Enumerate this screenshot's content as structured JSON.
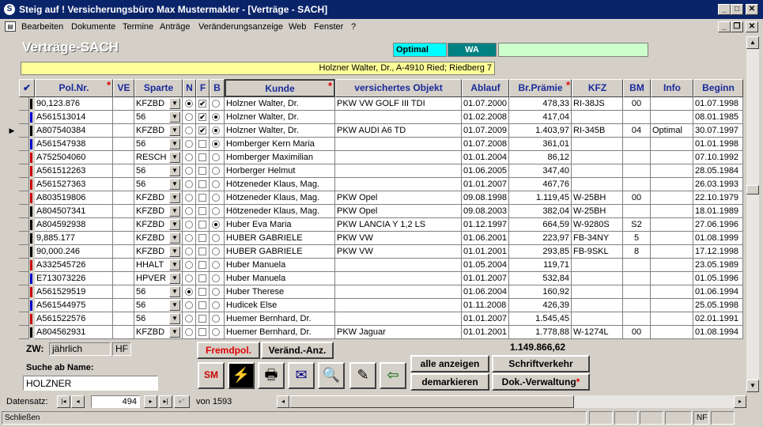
{
  "window": {
    "title": "Steig auf ! Versicherungsbüro Max Mustermakler - [Verträge - SACH]",
    "controls": {
      "minimize": "_",
      "maximize": "□",
      "close": "✕"
    },
    "mdi_controls": {
      "minimize": "_",
      "restore": "❐",
      "close": "✕"
    }
  },
  "menu": [
    "Bearbeiten",
    "Dokumente",
    "Termine",
    "Anträge",
    "Veränderungsanzeige",
    "Web",
    "Fenster",
    "?"
  ],
  "form": {
    "title": "Verträge-SACH",
    "badge1": "Optimal",
    "badge2": "WA",
    "badge3": "",
    "address": "Holzner Walter, Dr., A-4910 Ried; Riedberg 7"
  },
  "columns": {
    "check": "✔",
    "polnr": "Pol.Nr.",
    "ve": "VE",
    "sparte": "Sparte",
    "n": "N",
    "f": "F",
    "b": "B",
    "kunde": "Kunde",
    "objekt": "versichertes Objekt",
    "ablauf": "Ablauf",
    "praemie": "Br.Prämie",
    "kfz": "KFZ",
    "bm": "BM",
    "info": "Info",
    "beginn": "Beginn",
    "required_mark": "*"
  },
  "rows": [
    {
      "color": "#000000",
      "polnr": "90,123.876",
      "ve": "",
      "sparte": "KFZBD",
      "n": true,
      "f": true,
      "b": false,
      "kunde": "Holzner Walter, Dr.",
      "objekt": "PKW VW GOLF III TDI",
      "ablauf": "01.07.2000",
      "praemie": "478,33",
      "kfz": "RI-38JS",
      "bm": "00",
      "info": "",
      "beginn": "01.07.1998"
    },
    {
      "color": "#0000cc",
      "polnr": "A561513014",
      "ve": "",
      "sparte": "56",
      "n": false,
      "f": true,
      "b": true,
      "kunde": "Holzner Walter, Dr.",
      "objekt": "",
      "ablauf": "01.02.2008",
      "praemie": "417,04",
      "kfz": "",
      "bm": "",
      "info": "",
      "beginn": "08.01.1985"
    },
    {
      "color": "#000000",
      "polnr": "A807540384",
      "ve": "",
      "sparte": "KFZBD",
      "n": false,
      "f": true,
      "b": true,
      "kunde": "Holzner Walter, Dr.",
      "objekt": "PKW AUDI A6 TD",
      "ablauf": "01.07.2009",
      "praemie": "1.403,97",
      "kfz": "RI-345B",
      "bm": "04",
      "info": "Optimal",
      "beginn": "30.07.1997",
      "current": true
    },
    {
      "color": "#0000cc",
      "polnr": "A561547938",
      "ve": "",
      "sparte": "56",
      "n": false,
      "f": false,
      "b": true,
      "kunde": "Homberger Kern Maria",
      "objekt": "",
      "ablauf": "01.07.2008",
      "praemie": "361,01",
      "kfz": "",
      "bm": "",
      "info": "",
      "beginn": "01.01.1998"
    },
    {
      "color": "#cc0000",
      "polnr": "A752504060",
      "ve": "",
      "sparte": "RESCH",
      "n": false,
      "f": false,
      "b": false,
      "kunde": "Homberger Maximilian",
      "objekt": "",
      "ablauf": "01.01.2004",
      "praemie": "86,12",
      "kfz": "",
      "bm": "",
      "info": "",
      "beginn": "07.10.1992"
    },
    {
      "color": "#cc0000",
      "polnr": "A561512263",
      "ve": "",
      "sparte": "56",
      "n": false,
      "f": false,
      "b": false,
      "kunde": "Horberger Helmut",
      "objekt": "",
      "ablauf": "01.06.2005",
      "praemie": "347,40",
      "kfz": "",
      "bm": "",
      "info": "",
      "beginn": "28.05.1984"
    },
    {
      "color": "#cc0000",
      "polnr": "A561527363",
      "ve": "",
      "sparte": "56",
      "n": false,
      "f": false,
      "b": false,
      "kunde": "Hötzeneder Klaus, Mag.",
      "objekt": "",
      "ablauf": "01.01.2007",
      "praemie": "467,76",
      "kfz": "",
      "bm": "",
      "info": "",
      "beginn": "26.03.1993"
    },
    {
      "color": "#cc0000",
      "polnr": "A803519806",
      "ve": "",
      "sparte": "KFZBD",
      "n": false,
      "f": false,
      "b": false,
      "kunde": "Hötzeneder Klaus, Mag.",
      "objekt": "PKW Opel",
      "ablauf": "09.08.1998",
      "praemie": "1.119,45",
      "kfz": "W-25BH",
      "bm": "00",
      "info": "",
      "beginn": "22.10.1979"
    },
    {
      "color": "#000000",
      "polnr": "A804507341",
      "ve": "",
      "sparte": "KFZBD",
      "n": false,
      "f": false,
      "b": false,
      "kunde": "Hötzeneder Klaus, Mag.",
      "objekt": "PKW Opel",
      "ablauf": "09.08.2003",
      "praemie": "382,04",
      "kfz": "W-25BH",
      "bm": "",
      "info": "",
      "beginn": "18.01.1989"
    },
    {
      "color": "#000000",
      "polnr": "A804592938",
      "ve": "",
      "sparte": "KFZBD",
      "n": false,
      "f": false,
      "b": true,
      "kunde": "Huber Eva Maria",
      "objekt": "PKW LANCIA Y 1,2 LS",
      "ablauf": "01.12.1997",
      "praemie": "664,59",
      "kfz": "W-9280S",
      "bm": "S2",
      "info": "",
      "beginn": "27.06.1996"
    },
    {
      "color": "#000000",
      "polnr": "9,885.177",
      "ve": "",
      "sparte": "KFZBD",
      "n": false,
      "f": false,
      "b": false,
      "kunde": "HUBER GABRIELE",
      "objekt": "PKW VW",
      "ablauf": "01.06.2001",
      "praemie": "223,97",
      "kfz": "FB-34NY",
      "bm": "5",
      "info": "",
      "beginn": "01.08.1999"
    },
    {
      "color": "#000000",
      "polnr": "90,000.246",
      "ve": "",
      "sparte": "KFZBD",
      "n": false,
      "f": false,
      "b": false,
      "kunde": "HUBER GABRIELE",
      "objekt": "PKW VW",
      "ablauf": "01.01.2001",
      "praemie": "293,85",
      "kfz": "FB-9SKL",
      "bm": "8",
      "info": "",
      "beginn": "17.12.1998"
    },
    {
      "color": "#cc0000",
      "polnr": "A332545726",
      "ve": "",
      "sparte": "HHALT",
      "n": false,
      "f": false,
      "b": false,
      "kunde": "Huber Manuela",
      "objekt": "",
      "ablauf": "01.05.2004",
      "praemie": "119,71",
      "kfz": "",
      "bm": "",
      "info": "",
      "beginn": "23.05.1989"
    },
    {
      "color": "#0000cc",
      "polnr": "E713073226",
      "ve": "",
      "sparte": "HPVER",
      "n": false,
      "f": false,
      "b": false,
      "kunde": "Huber Manuela",
      "objekt": "",
      "ablauf": "01.01.2007",
      "praemie": "532,84",
      "kfz": "",
      "bm": "",
      "info": "",
      "beginn": "01.05.1996"
    },
    {
      "color": "#cc0000",
      "polnr": "A561529519",
      "ve": "",
      "sparte": "56",
      "n": true,
      "f": false,
      "b": false,
      "kunde": "Huber Therese",
      "objekt": "",
      "ablauf": "01.06.2004",
      "praemie": "160,92",
      "kfz": "",
      "bm": "",
      "info": "",
      "beginn": "01.06.1994"
    },
    {
      "color": "#0000cc",
      "polnr": "A561544975",
      "ve": "",
      "sparte": "56",
      "n": false,
      "f": false,
      "b": false,
      "kunde": "Hudicek Else",
      "objekt": "",
      "ablauf": "01.11.2008",
      "praemie": "426,39",
      "kfz": "",
      "bm": "",
      "info": "",
      "beginn": "25.05.1998"
    },
    {
      "color": "#cc0000",
      "polnr": "A561522576",
      "ve": "",
      "sparte": "56",
      "n": false,
      "f": false,
      "b": false,
      "kunde": "Huemer Bernhard, Dr.",
      "objekt": "",
      "ablauf": "01.01.2007",
      "praemie": "1.545,45",
      "kfz": "",
      "bm": "",
      "info": "",
      "beginn": "02.01.1991"
    },
    {
      "color": "#000000",
      "polnr": "A804562931",
      "ve": "",
      "sparte": "KFZBD",
      "n": false,
      "f": false,
      "b": false,
      "kunde": "Huemer Bernhard, Dr.",
      "objekt": "PKW Jaguar",
      "ablauf": "01.01.2001",
      "praemie": "1.778,88",
      "kfz": "W-1274L",
      "bm": "00",
      "info": "",
      "beginn": "01.08.1994"
    }
  ],
  "footer": {
    "zw_label": "ZW:",
    "zw_value": "jährlich",
    "zw_code": "HF",
    "search_label": "Suche ab Name:",
    "search_value": "HOLZNER",
    "fremdpol": "Fremdpol.",
    "veraend": "Veränd.-Anz.",
    "total": "1.149.866,62",
    "alle_anzeigen": "alle anzeigen",
    "schriftverkehr": "Schriftverkehr",
    "demarkieren": "demarkieren",
    "dok_verwaltung": "Dok.-Verwaltung",
    "required_mark": "*"
  },
  "nav": {
    "label": "Datensatz:",
    "current": "494",
    "of_label": "von",
    "total": "1593"
  },
  "status": {
    "text": "Schließen",
    "nf": "NF"
  },
  "icons": {
    "sm": "SM",
    "bolt": "⚡",
    "printer": "🖶",
    "mail": "✉",
    "search": "🔍",
    "edit": "✎",
    "exit": "⇦"
  }
}
